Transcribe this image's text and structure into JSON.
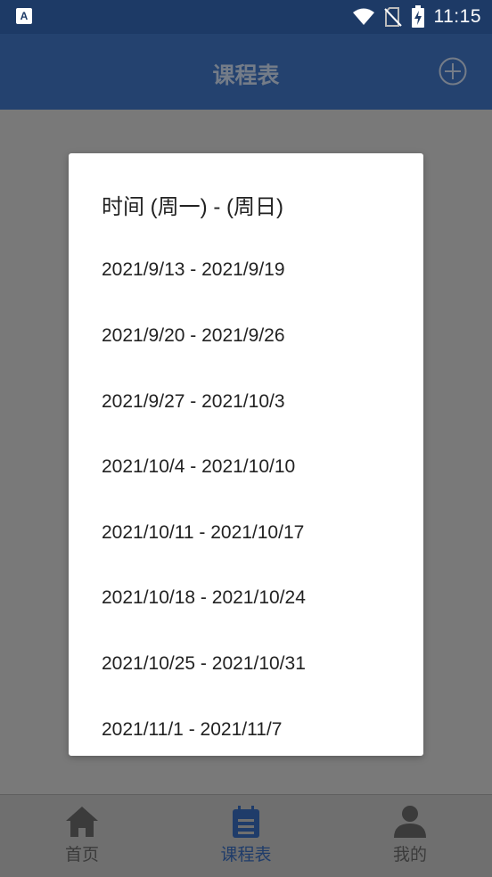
{
  "status_bar": {
    "time": "11:15",
    "icons": [
      "notification-app-icon",
      "wifi-icon",
      "no-sim-icon",
      "battery-charging-icon"
    ]
  },
  "app_bar": {
    "title": "课程表",
    "add_icon": "plus-circle-icon"
  },
  "dialog": {
    "title": "时间 (周一) - (周日)",
    "weeks": [
      "2021/9/13 - 2021/9/19",
      "2021/9/20 - 2021/9/26",
      "2021/9/27 - 2021/10/3",
      "2021/10/4 - 2021/10/10",
      "2021/10/11 - 2021/10/17",
      "2021/10/18 - 2021/10/24",
      "2021/10/25 - 2021/10/31",
      "2021/11/1 - 2021/11/7"
    ]
  },
  "bottom_nav": {
    "items": [
      {
        "label": "首页",
        "icon": "home-icon",
        "active": false
      },
      {
        "label": "课程表",
        "icon": "calendar-icon",
        "active": true
      },
      {
        "label": "我的",
        "icon": "person-icon",
        "active": false
      }
    ]
  },
  "colors": {
    "primary": "#24426f",
    "status_bar": "#1d3a66",
    "dim_overlay": "#797979"
  }
}
